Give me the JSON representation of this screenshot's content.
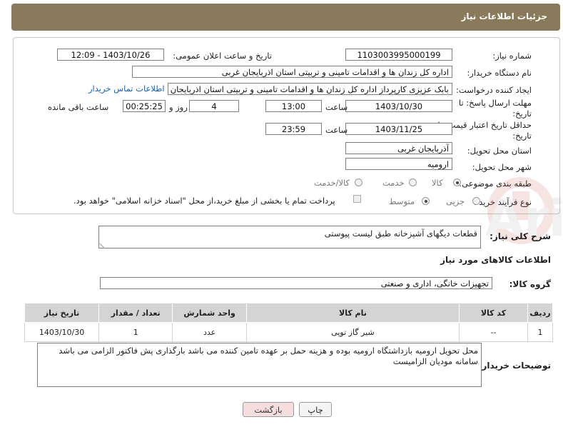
{
  "header": {
    "title": "جزئیات اطلاعات نیاز"
  },
  "form": {
    "need_number_label": "شماره نیاز:",
    "need_number": "1103003995000199",
    "announce_label": "تاریخ و ساعت اعلان عمومی:",
    "announce_value": "1403/10/26 - 12:09",
    "buyer_org_label": "نام دستگاه خریدار:",
    "buyer_org": "اداره کل زندان ها و اقدامات تامینی و تربیتی استان اذربایجان غربی",
    "creator_label": "ایجاد کننده درخواست:",
    "creator": "بابک عزیزی کارپرداز اداره کل زندان ها و اقدامات تامینی و تربیتی استان اذربایجان",
    "contact_link": "اطلاعات تماس خریدار",
    "deadline_label": "مهلت ارسال پاسخ: تا",
    "deadline_label2": "تاریخ:",
    "deadline_date": "1403/10/30",
    "hour_label": "ساعت",
    "deadline_hour": "13:00",
    "days_value": "4",
    "days_label": "روز و",
    "remaining_value": "00:25:25",
    "remaining_label": "ساعت باقی مانده",
    "validity_label": "حداقل تاریخ اعتبار قیمت: تا",
    "validity_label2": "تاریخ:",
    "validity_date": "1403/11/25",
    "validity_hour": "23:59",
    "province_label": "استان محل تحویل:",
    "province": "آذربایجان غربی",
    "city_label": "شهر محل تحویل:",
    "city": "ارومیه",
    "category_label": "طبقه بندی موضوعی:",
    "cat_goods": "کالا",
    "cat_service": "خدمت",
    "cat_goods_service": "کالا/خدمت",
    "process_label": "نوع فرآیند خرید :",
    "proc_partial": "جزیی",
    "proc_medium": "متوسط",
    "payment_note": "پرداخت تمام یا بخشی از مبلغ خرید،از محل \"اسناد خزانه اسلامی\" خواهد بود."
  },
  "summary": {
    "label": "شرح کلی نیاز:",
    "value": "قطعات دیگهای آشپزخانه طبق لیست پیوستی"
  },
  "goods_info": {
    "title": "اطلاعات کالاهای مورد نیاز",
    "group_label": "گروه کالا:",
    "group_value": "تجهیزات خانگی، اداری و صنعتی"
  },
  "table": {
    "headers": [
      "ردیف",
      "کد کالا",
      "نام کالا",
      "واحد شمارش",
      "تعداد / مقدار",
      "تاریخ نیاز"
    ],
    "rows": [
      [
        "1",
        "--",
        "شیر گاز توپی",
        "عدد",
        "1",
        "1403/10/30"
      ]
    ]
  },
  "buyer_notes": {
    "label": "توضیحات خریدار:",
    "value": "محل تحویل ارومیه بازداشتگاه ارومیه  بوده و هزینه حمل   بر عهده تامین کننده می باشد  بارگذاری پش فاکتور الزامی می باشد سامانه مودیان الزامیست"
  },
  "buttons": {
    "print": "چاپ",
    "back": "بازگشت"
  },
  "colors": {
    "header_bg": "#8a7a5c",
    "link": "#1a5fb4",
    "back_button_bg": "#f6dede"
  }
}
